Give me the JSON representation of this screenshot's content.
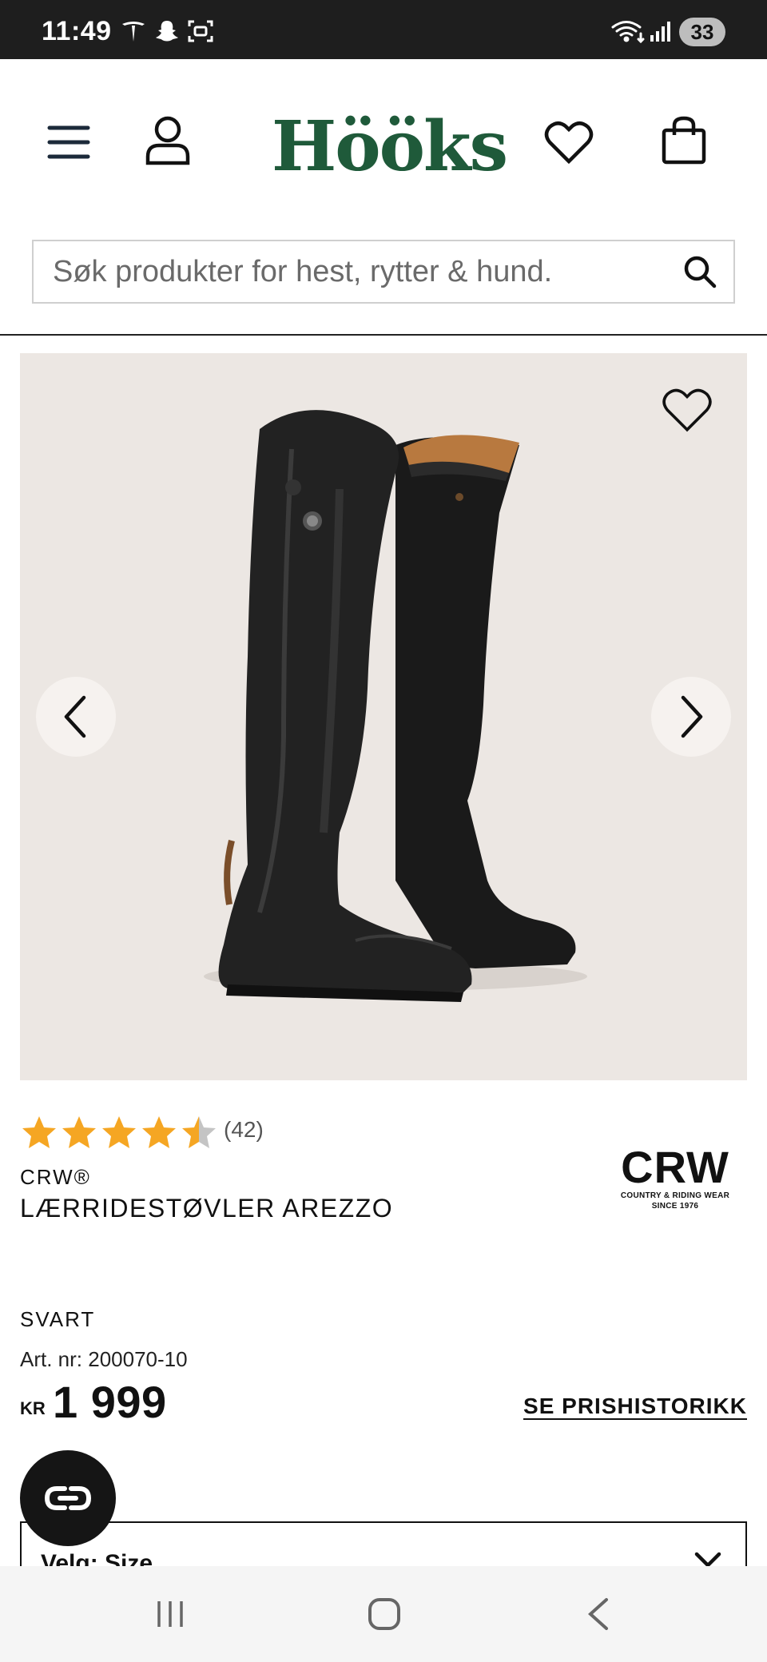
{
  "status_bar": {
    "time": "11:49",
    "battery": "33",
    "icons": [
      "tesla-icon",
      "snapchat-icon",
      "screenshot-icon",
      "wifi-icon",
      "signal-icon"
    ]
  },
  "header": {
    "logo": "Hööks",
    "icons": [
      "menu-icon",
      "account-icon",
      "wishlist-icon",
      "cart-icon"
    ]
  },
  "search": {
    "placeholder": "Søk produkter for hest, rytter & hund."
  },
  "product": {
    "rating": 4.5,
    "review_count": "(42)",
    "brand": "CRW®",
    "name": "LÆRRIDESTØVLER AREZZO",
    "brand_logo": {
      "main": "CRW",
      "tagline": "COUNTRY & RIDING WEAR",
      "since": "SINCE 1976"
    },
    "color": "SVART",
    "art_nr": "Art. nr: 200070-10",
    "currency": "KR",
    "price": "1 999",
    "price_history_link": "SE PRISHISTORIKK",
    "size_select": "Velg: Size"
  },
  "colors": {
    "logo_green": "#1f5a3a",
    "star": "#f5a623",
    "image_bg": "#ece7e3"
  }
}
